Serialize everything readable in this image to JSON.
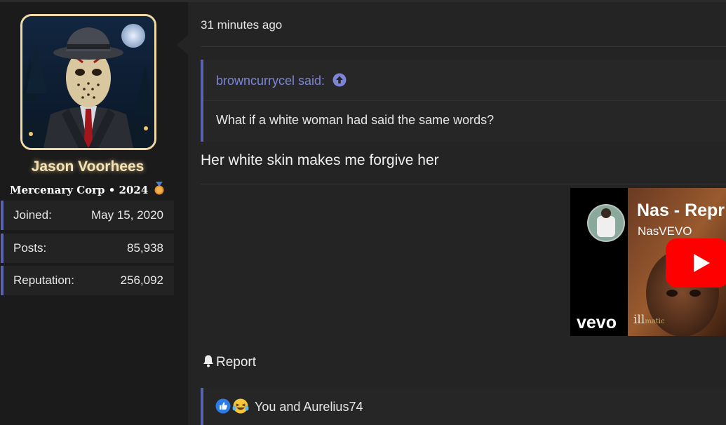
{
  "user": {
    "name": "Jason Voorhees",
    "title": "Mercenary Corp • 2024",
    "stats": [
      {
        "label": "Joined:",
        "value": "May 15, 2020"
      },
      {
        "label": "Posts:",
        "value": "85,938"
      },
      {
        "label": "Reputation:",
        "value": "256,092"
      }
    ]
  },
  "post": {
    "timestamp": "31 minutes ago",
    "quote": {
      "author_line": "browncurrycel said:",
      "text": "What if a white woman had said the same words?"
    },
    "message": "Her white skin makes me forgive her",
    "video": {
      "title": "Nas - Repr",
      "channel": "NasVEVO",
      "brand": "vevo",
      "album_text_main": "ill",
      "album_text_small": "matic"
    },
    "report_label": "Report",
    "reactions_text": "You and Aurelius74"
  },
  "colors": {
    "accent_border": "#5a63b3",
    "quote_link": "#7d84d6",
    "username_glow": "#f5e3b6",
    "youtube_red": "#ff0000"
  },
  "icons": [
    "up-arrow-circle-icon",
    "bell-icon",
    "like-icon",
    "haha-icon",
    "medal-icon",
    "play-icon"
  ]
}
